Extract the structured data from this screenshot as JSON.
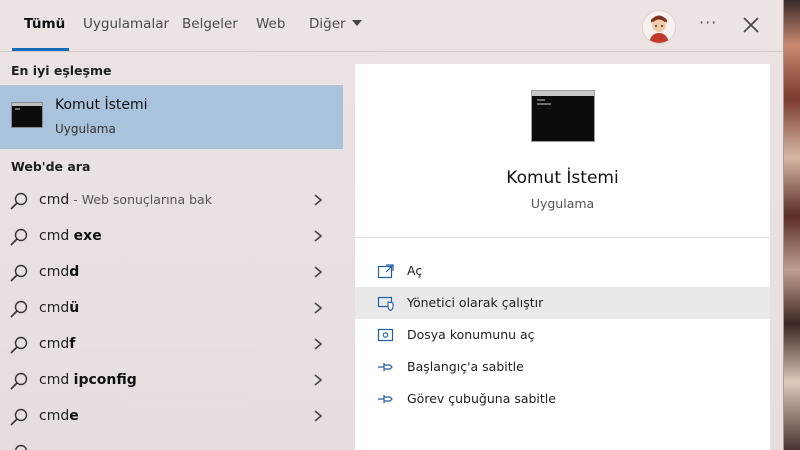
{
  "tabs": [
    {
      "label": "Tümü",
      "active": true
    },
    {
      "label": "Uygulamalar"
    },
    {
      "label": "Belgeler"
    },
    {
      "label": "Web"
    },
    {
      "label": "Diğer"
    }
  ],
  "header": {
    "more_label": "···"
  },
  "best_match": {
    "heading": "En iyi eşleşme",
    "title": "Komut İstemi",
    "subtitle": "Uygulama"
  },
  "web_search": {
    "heading": "Web'de ara",
    "results": [
      {
        "prefix": "cmd",
        "bold": "",
        "hint": " - Web sonuçlarına bak"
      },
      {
        "prefix": "cmd ",
        "bold": "exe",
        "hint": ""
      },
      {
        "prefix": "cmd",
        "bold": "d",
        "hint": ""
      },
      {
        "prefix": "cmd",
        "bold": "ü",
        "hint": ""
      },
      {
        "prefix": "cmd",
        "bold": "f",
        "hint": ""
      },
      {
        "prefix": "cmd ",
        "bold": "ipconfig",
        "hint": ""
      },
      {
        "prefix": "cmd",
        "bold": "e",
        "hint": ""
      }
    ]
  },
  "preview": {
    "title": "Komut İstemi",
    "subtitle": "Uygulama",
    "actions": [
      {
        "label": "Aç",
        "icon": "open-icon"
      },
      {
        "label": "Yönetici olarak çalıştır",
        "icon": "shield-run-as-admin-icon"
      },
      {
        "label": "Dosya konumunu aç",
        "icon": "file-location-icon"
      },
      {
        "label": "Başlangıç'a sabitle",
        "icon": "pin-icon"
      },
      {
        "label": "Görev çubuğuna sabitle",
        "icon": "pin-icon"
      }
    ]
  },
  "colors": {
    "accent": "#0f6cbd",
    "selected": "#a9c3dc",
    "hover": "#e9e9e9"
  }
}
